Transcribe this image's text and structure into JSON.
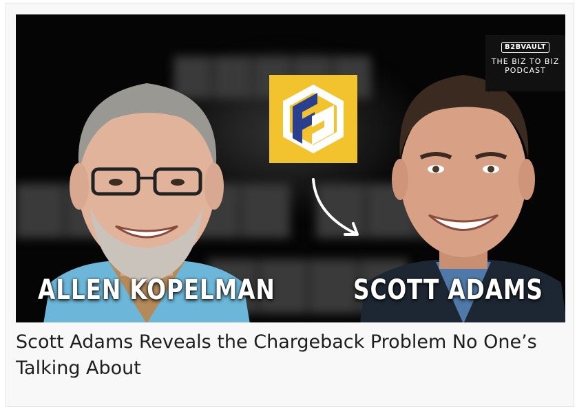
{
  "card": {
    "title": "Scott Adams Reveals the Chargeback Problem No One’s Talking About"
  },
  "thumbnail": {
    "guest_left_name": "ALLEN KOPELMAN",
    "guest_right_name": "SCOTT ADAMS",
    "badge": {
      "brand": "B2BVAULT",
      "line1": "THE BIZ TO BIZ",
      "line2": "PODCAST"
    },
    "logo_icon": "fd-hexagon-logo-icon",
    "arrow_icon": "curved-arrow-icon",
    "colors": {
      "logo_bg": "#f3c32e",
      "logo_blue": "#2b3f8f",
      "background": "#050505"
    }
  }
}
